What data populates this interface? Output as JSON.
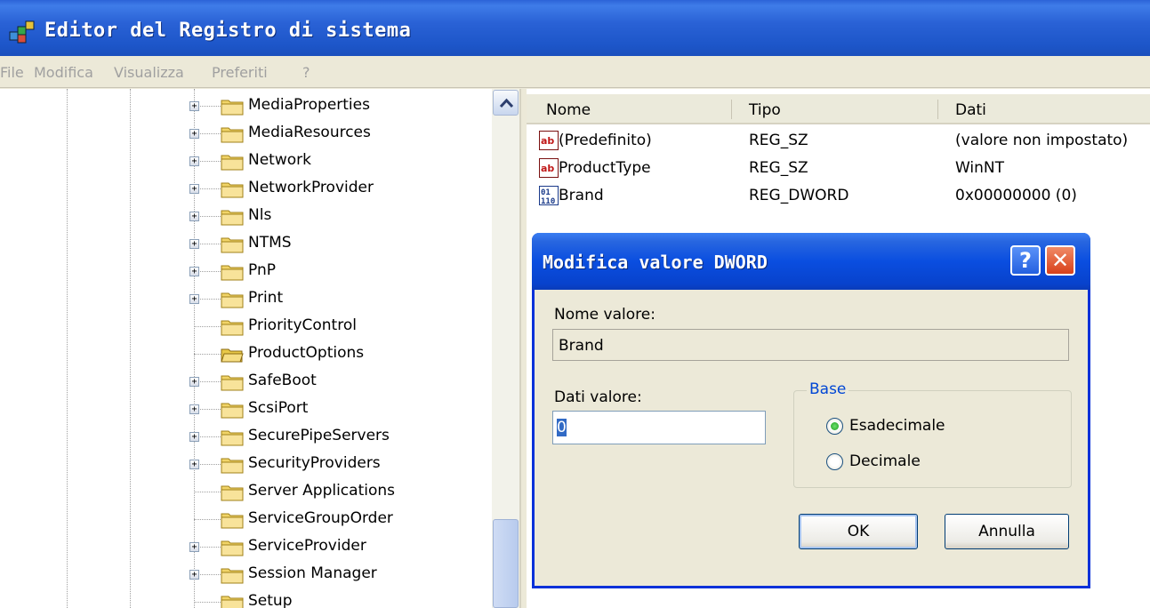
{
  "window": {
    "title": "Editor del Registro di sistema"
  },
  "menu": [
    "File",
    "Modifica",
    "Visualizza",
    "Preferiti",
    "?"
  ],
  "tree": {
    "items": [
      {
        "label": "MediaProperties",
        "expandable": true
      },
      {
        "label": "MediaResources",
        "expandable": true
      },
      {
        "label": "Network",
        "expandable": true
      },
      {
        "label": "NetworkProvider",
        "expandable": true
      },
      {
        "label": "Nls",
        "expandable": true
      },
      {
        "label": "NTMS",
        "expandable": true
      },
      {
        "label": "PnP",
        "expandable": true
      },
      {
        "label": "Print",
        "expandable": true
      },
      {
        "label": "PriorityControl",
        "expandable": false
      },
      {
        "label": "ProductOptions",
        "expandable": false,
        "selected": true
      },
      {
        "label": "SafeBoot",
        "expandable": true
      },
      {
        "label": "ScsiPort",
        "expandable": true
      },
      {
        "label": "SecurePipeServers",
        "expandable": true
      },
      {
        "label": "SecurityProviders",
        "expandable": true
      },
      {
        "label": "Server Applications",
        "expandable": false
      },
      {
        "label": "ServiceGroupOrder",
        "expandable": false
      },
      {
        "label": "ServiceProvider",
        "expandable": true
      },
      {
        "label": "Session Manager",
        "expandable": true
      },
      {
        "label": "Setup",
        "expandable": false
      }
    ]
  },
  "list": {
    "headers": {
      "name": "Nome",
      "type": "Tipo",
      "data": "Dati"
    },
    "rows": [
      {
        "icon": "string-value-icon",
        "name": "(Predefinito)",
        "type": "REG_SZ",
        "data": "(valore non impostato)"
      },
      {
        "icon": "string-value-icon",
        "name": "ProductType",
        "type": "REG_SZ",
        "data": "WinNT"
      },
      {
        "icon": "binary-value-icon",
        "name": "Brand",
        "type": "REG_DWORD",
        "data": "0x00000000 (0)"
      }
    ]
  },
  "dialog": {
    "title": "Modifica valore DWORD",
    "help_glyph": "?",
    "close_glyph": "✕",
    "value_name_label": "Nome valore:",
    "value_name": "Brand",
    "value_data_label": "Dati valore:",
    "value_data": "0",
    "base_label": "Base",
    "radio_hex": "Esadecimale",
    "radio_dec": "Decimale",
    "selected_base": "hex",
    "ok_label": "OK",
    "cancel_label": "Annulla"
  },
  "colors": {
    "titlebar": "#1d56c9",
    "dialog_titlebar": "#0a4ee0",
    "selection": "#316ac5",
    "group_label": "#0046d5"
  }
}
